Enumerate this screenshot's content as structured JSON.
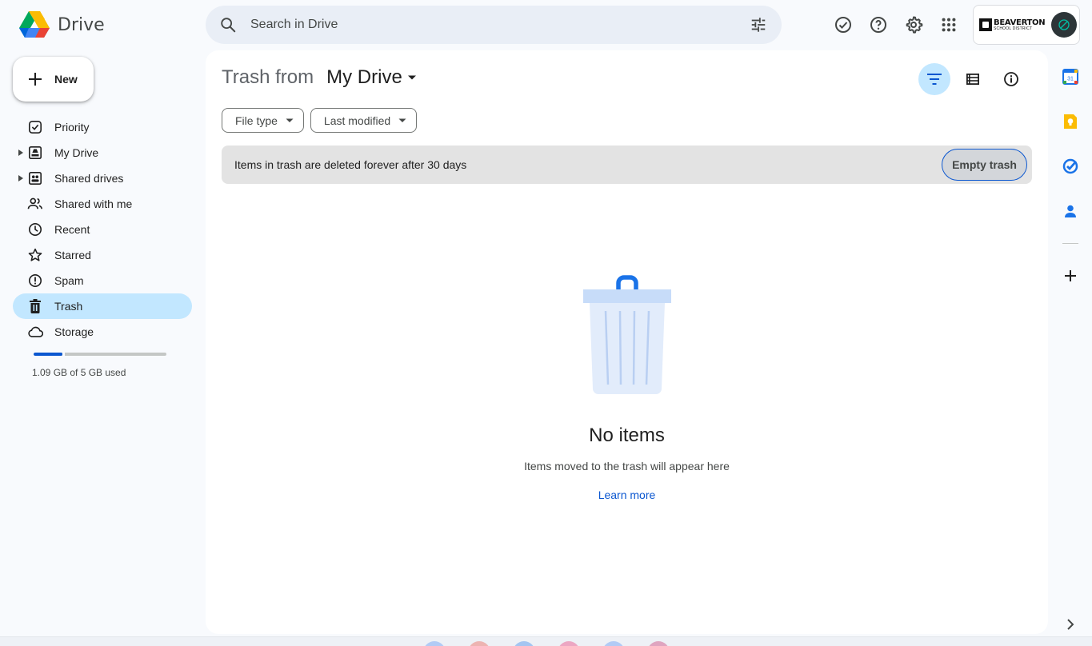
{
  "app": {
    "name": "Drive"
  },
  "search": {
    "placeholder": "Search in Drive"
  },
  "account": {
    "org_name": "BEAVERTON",
    "org_sub": "SCHOOL DISTRICT"
  },
  "new_button": {
    "label": "New"
  },
  "nav": {
    "items": [
      {
        "label": "Priority",
        "icon": "priority-icon"
      },
      {
        "label": "My Drive",
        "icon": "my-drive-icon"
      },
      {
        "label": "Shared drives",
        "icon": "shared-drives-icon"
      },
      {
        "label": "Shared with me",
        "icon": "shared-with-me-icon"
      },
      {
        "label": "Recent",
        "icon": "clock-icon"
      },
      {
        "label": "Starred",
        "icon": "star-icon"
      },
      {
        "label": "Spam",
        "icon": "spam-icon"
      },
      {
        "label": "Trash",
        "icon": "trash-icon",
        "active": true
      },
      {
        "label": "Storage",
        "icon": "cloud-icon"
      }
    ]
  },
  "storage": {
    "text": "1.09 GB of 5 GB used",
    "used_fraction": 0.218,
    "color": "#0b57d0"
  },
  "main": {
    "title_prefix": "Trash from",
    "title_location": "My Drive",
    "filters": {
      "file_type": "File type",
      "last_modified": "Last modified"
    },
    "banner": {
      "text": "Items in trash are deleted forever after 30 days",
      "button": "Empty trash"
    },
    "empty": {
      "title": "No items",
      "subtitle": "Items moved to the trash will appear here",
      "link": "Learn more"
    }
  },
  "colors": {
    "accent": "#0b57d0",
    "selected": "#c2e7ff",
    "search_bg": "#e9eef6"
  }
}
